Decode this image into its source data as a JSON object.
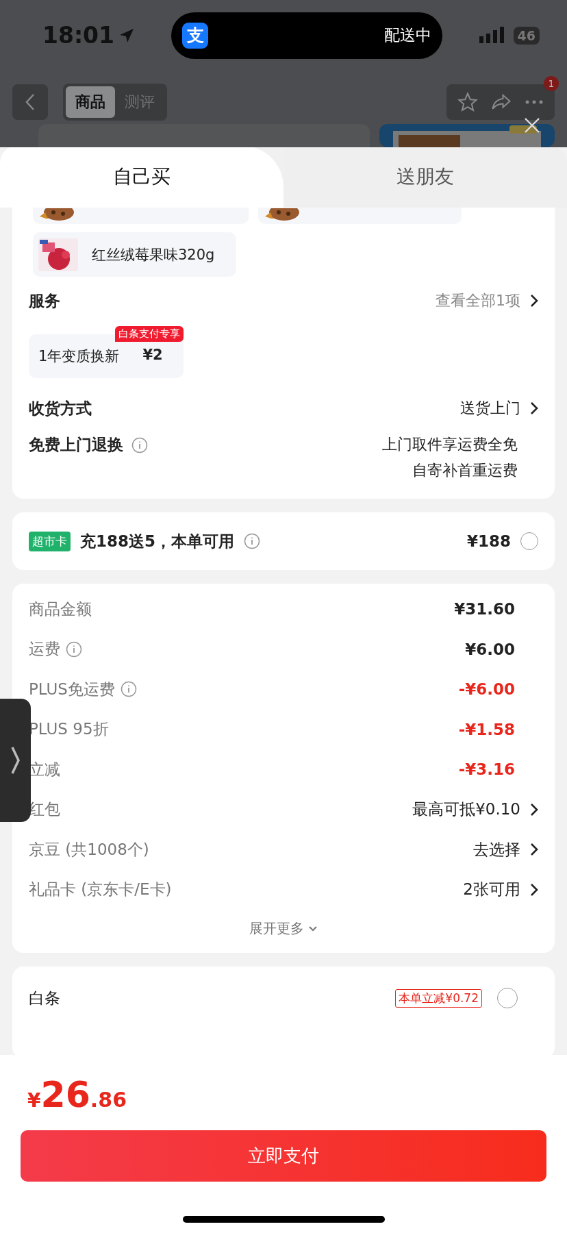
{
  "status_bar": {
    "time": "18:01",
    "island_icon": "支",
    "island_text": "配送中",
    "battery": "46"
  },
  "nav": {
    "segments": [
      {
        "label": "商品",
        "selected": true
      },
      {
        "label": "测评",
        "selected": false
      }
    ],
    "badge": "1"
  },
  "sheet_tabs": [
    {
      "label": "自己买",
      "selected": true
    },
    {
      "label": "送朋友",
      "selected": false
    }
  ],
  "items": [
    {
      "name": "红丝绒莓果味320g"
    }
  ],
  "service": {
    "title": "服务",
    "link": "查看全部1项",
    "option": {
      "name": "1年变质换新",
      "price": "¥2",
      "tag": "白条支付专享"
    }
  },
  "delivery": {
    "label": "收货方式",
    "value": "送货上门"
  },
  "returns": {
    "label": "免费上门退换",
    "lines": [
      "上门取件享运费全免",
      "自寄补首重运费"
    ]
  },
  "card_offer": {
    "tag": "超市卡",
    "text": "充188送5，本单可用",
    "price": "¥188",
    "checked": false
  },
  "summary": [
    {
      "label": "商品金额",
      "info": false,
      "value": "¥31.60",
      "kind": "amount"
    },
    {
      "label": "运费",
      "info": true,
      "value": "¥6.00",
      "kind": "amount"
    },
    {
      "label": "PLUS免运费",
      "info": true,
      "value": "-¥6.00",
      "kind": "discount"
    },
    {
      "label": "PLUS 95折",
      "info": false,
      "value": "-¥1.58",
      "kind": "discount"
    },
    {
      "label": "立减",
      "info": false,
      "value": "-¥3.16",
      "kind": "discount"
    },
    {
      "label": "红包",
      "info": false,
      "value": "最高可抵¥0.10",
      "kind": "link"
    },
    {
      "label": "京豆 (共1008个)",
      "info": false,
      "value": "去选择",
      "kind": "link"
    },
    {
      "label": "礼品卡 (京东卡/E卡)",
      "info": false,
      "value": "2张可用",
      "kind": "link"
    }
  ],
  "expand": "展开更多",
  "payment": {
    "label": "白条",
    "tag": "本单立减¥0.72",
    "checked": false
  },
  "total": {
    "currency": "¥",
    "integer": "26",
    "decimal": ".86"
  },
  "pay_button": "立即支付"
}
